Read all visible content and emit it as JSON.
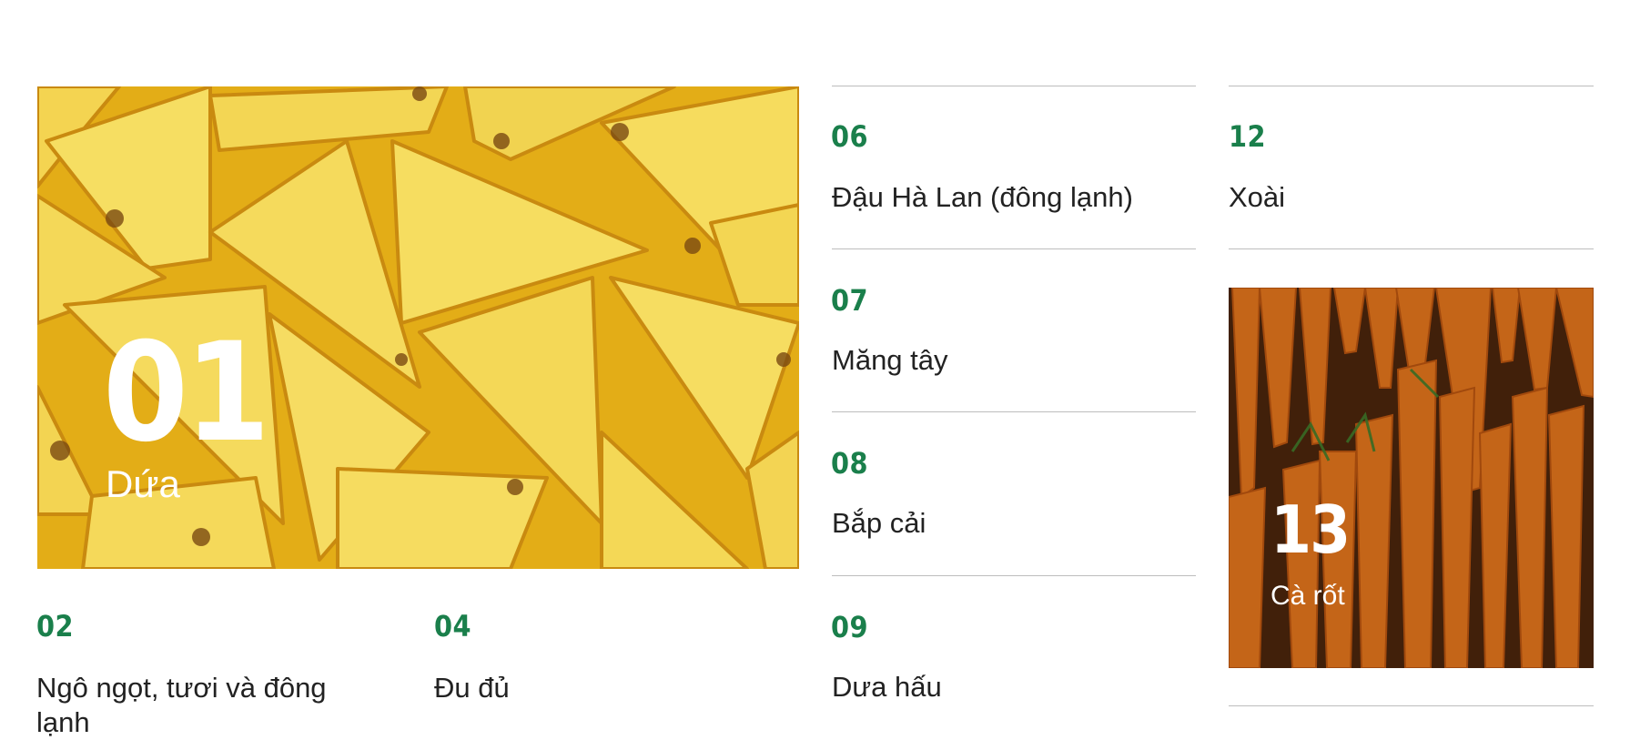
{
  "featured": {
    "number": "01",
    "name": "Dứa"
  },
  "left_items": [
    {
      "number": "02",
      "name": "Ngô ngọt, tươi và đông lạnh"
    },
    {
      "number": "04",
      "name": "Đu đủ"
    }
  ],
  "middle_items": [
    {
      "number": "06",
      "name": "Đậu Hà Lan (đông lạnh)"
    },
    {
      "number": "07",
      "name": "Măng tây"
    },
    {
      "number": "08",
      "name": "Bắp cải"
    },
    {
      "number": "09",
      "name": "Dưa hấu"
    }
  ],
  "right_items": [
    {
      "number": "12",
      "name": "Xoài"
    }
  ],
  "carrot_card": {
    "number": "13",
    "name": "Cà rốt"
  },
  "colors": {
    "accent_green": "#1a7f4b",
    "divider": "#bdbdbd"
  }
}
